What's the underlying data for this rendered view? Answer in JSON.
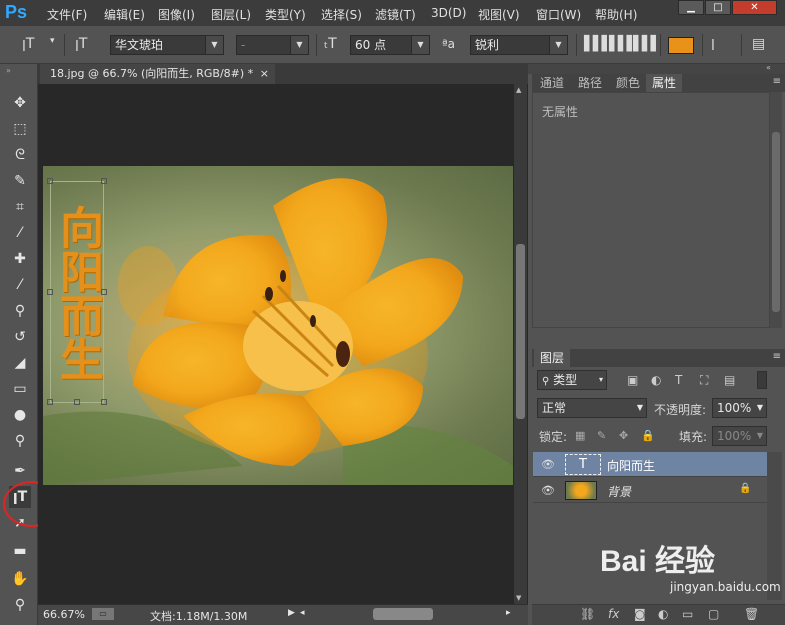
{
  "app": {
    "logo": "Ps"
  },
  "menu": [
    {
      "label": "文件(F)"
    },
    {
      "label": "编辑(E)"
    },
    {
      "label": "图像(I)"
    },
    {
      "label": "图层(L)"
    },
    {
      "label": "类型(Y)"
    },
    {
      "label": "选择(S)"
    },
    {
      "label": "滤镜(T)"
    },
    {
      "label": "3D(D)"
    },
    {
      "label": "视图(V)"
    },
    {
      "label": "窗口(W)"
    },
    {
      "label": "帮助(H)"
    }
  ],
  "window_buttons": {
    "minimize": "▁",
    "maximize": "□",
    "close": "✕"
  },
  "options": {
    "font_family": "华文琥珀",
    "font_style": "-",
    "font_size": "60 点",
    "anti_alias": "锐利",
    "text_color": "#e8921a"
  },
  "document": {
    "tab_title": "18.jpg @ 66.7% (向阳而生, RGB/8#) *",
    "tab_close": "×",
    "text_layer_content": "向阳而生",
    "text_color": "#e3901c",
    "zoom": "66.67%",
    "file_info": "文档:1.18M/1.30M"
  },
  "panels": {
    "top_tabs": [
      "通道",
      "路径",
      "颜色",
      "属性"
    ],
    "active_top_tab": "属性",
    "properties_text": "无属性",
    "layers_tab": "图层",
    "filter_kind": "类型",
    "blend_mode": "正常",
    "opacity_label": "不透明度:",
    "opacity_value": "100%",
    "lock_label": "锁定:",
    "fill_label": "填充:",
    "fill_value": "100%",
    "layers": [
      {
        "name": "向阳而生",
        "type": "text",
        "thumb": "T",
        "selected": true
      },
      {
        "name": "背景",
        "type": "image",
        "selected": false
      }
    ]
  },
  "watermark": {
    "brand": "Bai 经验",
    "url": "jingyan.baidu.com"
  },
  "colors": {
    "accent": "#31a8ff",
    "highlight_circle": "#e02424",
    "selected_layer": "#6f84a3"
  }
}
